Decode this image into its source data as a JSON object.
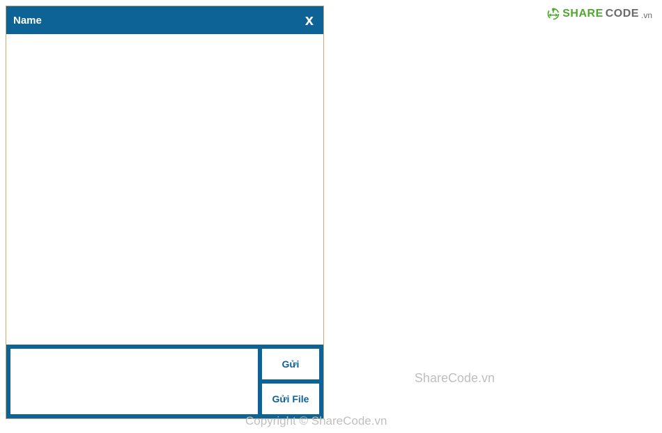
{
  "chat": {
    "title": "Name",
    "close": "x",
    "input_placeholder": "",
    "send_label": "Gửi",
    "send_file_label": "Gửi File"
  },
  "watermark": {
    "logo_share": "SHARE",
    "logo_code": "CODE",
    "logo_vn": ".vn",
    "text_center": "ShareCode.vn",
    "copyright": "Copyright © ShareCode.vn"
  }
}
